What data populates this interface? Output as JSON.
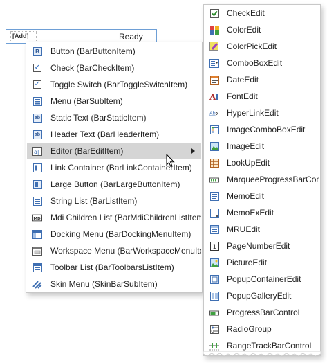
{
  "bar": {
    "add_label": "[Add]",
    "status": "Ready"
  },
  "menu1": {
    "items": [
      {
        "label": "Button (BarButtonItem)",
        "icon": "button-icon"
      },
      {
        "label": "Check (BarCheckItem)",
        "icon": "check-icon"
      },
      {
        "label": "Toggle Switch (BarToggleSwitchItem)",
        "icon": "toggle-switch-icon"
      },
      {
        "label": "Menu (BarSubItem)",
        "icon": "menu-icon"
      },
      {
        "label": "Static Text (BarStaticItem)",
        "icon": "static-text-icon"
      },
      {
        "label": "Header Text (BarHeaderItem)",
        "icon": "header-text-icon"
      },
      {
        "label": "Editor (BarEditItem)",
        "icon": "editor-icon"
      },
      {
        "label": "Link Container (BarLinkContainerItem)",
        "icon": "link-container-icon"
      },
      {
        "label": "Large Button (BarLargeButtonItem)",
        "icon": "large-button-icon"
      },
      {
        "label": "String List (BarListItem)",
        "icon": "string-list-icon"
      },
      {
        "label": "Mdi Children List (BarMdiChildrenListItem)",
        "icon": "mdi-children-list-icon"
      },
      {
        "label": "Docking Menu (BarDockingMenuItem)",
        "icon": "docking-menu-icon"
      },
      {
        "label": "Workspace Menu (BarWorkspaceMenuItem)",
        "icon": "workspace-menu-icon"
      },
      {
        "label": "Toolbar List (BarToolbarsListItem)",
        "icon": "toolbar-list-icon"
      },
      {
        "label": "Skin Menu (SkinBarSubItem)",
        "icon": "skin-menu-icon"
      }
    ]
  },
  "menu2": {
    "items": [
      {
        "label": "CheckEdit",
        "icon": "checkedit-icon"
      },
      {
        "label": "ColorEdit",
        "icon": "coloredit-icon"
      },
      {
        "label": "ColorPickEdit",
        "icon": "colorpickedit-icon"
      },
      {
        "label": "ComboBoxEdit",
        "icon": "comboboxedit-icon"
      },
      {
        "label": "DateEdit",
        "icon": "dateedit-icon"
      },
      {
        "label": "FontEdit",
        "icon": "fontedit-icon"
      },
      {
        "label": "HyperLinkEdit",
        "icon": "hyperlinkedit-icon"
      },
      {
        "label": "ImageComboBoxEdit",
        "icon": "imagecomboboxedit-icon"
      },
      {
        "label": "ImageEdit",
        "icon": "imageedit-icon"
      },
      {
        "label": "LookUpEdit",
        "icon": "lookupedit-icon"
      },
      {
        "label": "MarqueeProgressBarControl",
        "icon": "marqueeprogressbar-icon"
      },
      {
        "label": "MemoEdit",
        "icon": "memoedit-icon"
      },
      {
        "label": "MemoExEdit",
        "icon": "memoexedit-icon"
      },
      {
        "label": "MRUEdit",
        "icon": "mruedit-icon"
      },
      {
        "label": "PageNumberEdit",
        "icon": "pagenumberedit-icon"
      },
      {
        "label": "PictureEdit",
        "icon": "pictureedit-icon"
      },
      {
        "label": "PopupContainerEdit",
        "icon": "popupcontaineredit-icon"
      },
      {
        "label": "PopupGalleryEdit",
        "icon": "popupgalleryedit-icon"
      },
      {
        "label": "ProgressBarControl",
        "icon": "progressbarcontrol-icon"
      },
      {
        "label": "RadioGroup",
        "icon": "radiogroup-icon"
      },
      {
        "label": "RangeTrackBarControl",
        "icon": "rangetrackbar-icon"
      }
    ]
  },
  "colors": {
    "highlight": "#d5d5d5",
    "border": "#c8c8c8",
    "accent": "#3f6fb2"
  }
}
